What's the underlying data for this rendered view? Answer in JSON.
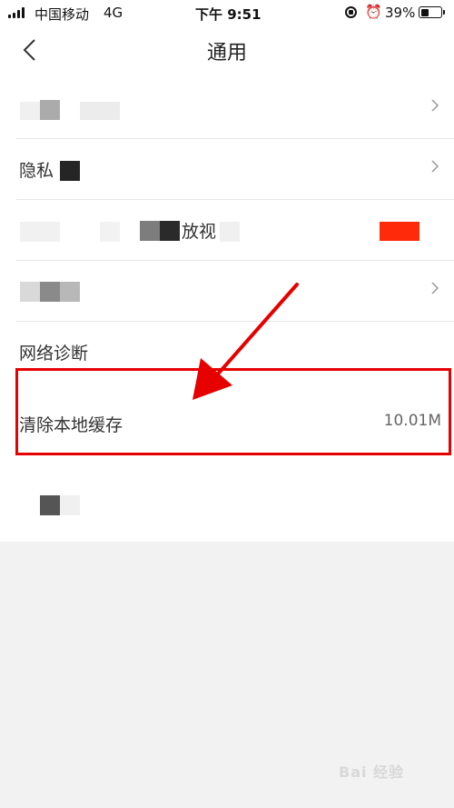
{
  "status_bar": {
    "carrier": "中国移动",
    "network": "4G",
    "time": "下午 9:51",
    "battery_percent": "39%",
    "battery_level": 0.39,
    "icons": [
      "signal-icon",
      "orientation-lock-icon",
      "alarm-icon",
      "battery-icon"
    ]
  },
  "nav": {
    "title": "通用",
    "back_icon": "chevron-left-icon"
  },
  "list": {
    "rows": [
      {
        "label": "",
        "has_chevron": true
      },
      {
        "label": "隐私",
        "has_chevron": true
      },
      {
        "label": "放视",
        "has_chevron": false
      },
      {
        "label": "",
        "has_chevron": true
      },
      {
        "label": "网络诊断",
        "has_chevron": false
      },
      {
        "label": "清除本地缓存",
        "value": "10.01M",
        "has_chevron": false
      },
      {
        "label": "",
        "has_chevron": false
      }
    ]
  },
  "annotation": {
    "highlight_color": "#e60000",
    "arrow_color": "#e60000"
  },
  "watermark": "Bai 经验"
}
